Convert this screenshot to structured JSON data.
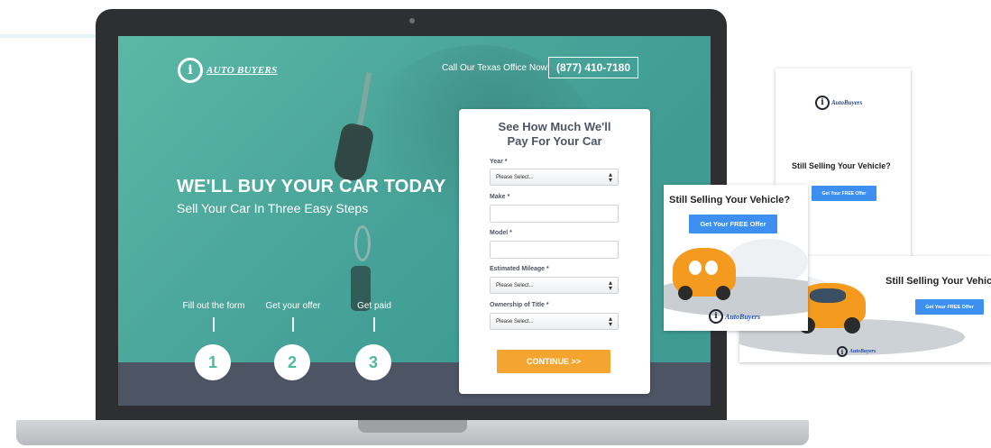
{
  "landing": {
    "logo_letter": "i",
    "logo_text": "AUTO BUYERS",
    "call_text": "Call Our Texas Office Now!",
    "phone": "(877) 410-7180",
    "hero_title": "WE'LL BUY YOUR CAR TODAY",
    "hero_subtitle": "Sell Your Car In Three Easy Steps",
    "steps": [
      {
        "label": "Fill out the form",
        "number": "1"
      },
      {
        "label": "Get your offer",
        "number": "2"
      },
      {
        "label": "Get paid",
        "number": "3"
      }
    ]
  },
  "form": {
    "title_line1": "See How Much We'll",
    "title_line2": "Pay For Your Car",
    "year_label": "Year *",
    "year_value": "Please Select...",
    "make_label": "Make *",
    "model_label": "Model *",
    "mileage_label": "Estimated Mileage *",
    "mileage_value": "Please Select...",
    "title_label": "Ownership of Title *",
    "title_value": "Please Select...",
    "continue_label": "CONTINUE >>"
  },
  "ads": {
    "headline": "Still Selling Your Vehicle?",
    "cta": "Get Your FREE Offer",
    "logo_text": "AutoBuyers"
  },
  "colors": {
    "teal": "#4aa59a",
    "dark_band": "#4d5463",
    "orange_button": "#f3a530",
    "blue_button": "#3d8ff0",
    "step_number": "#4cb9a0"
  }
}
